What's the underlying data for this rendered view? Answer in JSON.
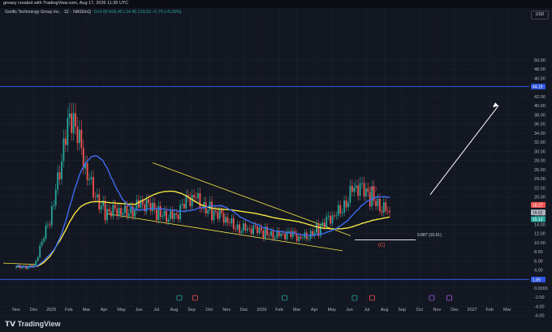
{
  "header": {
    "credit": "greasy created with TradingView.com, Aug 17, 2026 11:35 UTC"
  },
  "legend": {
    "symbol": "Gorilla Technology Group Inc. · 1D · NASDAQ",
    "ohlc": "O14.85 H16.48 L14.45 C16.62 +0.79 (+5.28%)"
  },
  "currency": "USD",
  "footer": {
    "brand": "TradingView",
    "brand_icon": "tradingview-logo-icon"
  },
  "price_axis": [
    "50.00",
    "48.00",
    "46.00",
    "42.00",
    "40.00",
    "38.00",
    "36.00",
    "34.00",
    "32.00",
    "30.00",
    "28.00",
    "26.00",
    "24.00",
    "22.00",
    "20.00",
    "18.00",
    "16.00",
    "14.00",
    "12.00",
    "10.00",
    "8.00",
    "6.00",
    "4.00",
    "2.00",
    "0.0000",
    "-2.00",
    "-4.00",
    "-6.00"
  ],
  "time_axis": [
    "Nov",
    "Dec",
    "2025",
    "Feb",
    "Mar",
    "Apr",
    "May",
    "Jun",
    "Jul",
    "Aug",
    "Sep",
    "Oct",
    "Nov",
    "Dec",
    "2026",
    "Feb",
    "Mar",
    "Apr",
    "May",
    "Jun",
    "Jul",
    "Aug",
    "Sep",
    "Oct",
    "Nov",
    "Dec",
    "2027",
    "Feb",
    "Mar"
  ],
  "price_tags": {
    "resistance": "44.19",
    "last_red": "18.27",
    "last_gray": "16.62",
    "last_green": "15.13",
    "support": "1.89"
  },
  "annotations": {
    "wave_b": "(B)",
    "wave_c": "(C)",
    "fib": "0.887 (10.61)"
  },
  "colors": {
    "up": "#26a69a",
    "down": "#ef5350",
    "ma_yellow": "#f5e642",
    "ma_blue": "#3d6cf0",
    "hline": "#3055e0"
  },
  "chart_data": {
    "type": "candlestick",
    "title": "Gorilla Technology Group Inc. · 1D · NASDAQ",
    "ylim": [
      -6,
      51
    ],
    "grid": true,
    "horizontal_lines": [
      44.19,
      1.89
    ],
    "approx_close_path": [
      {
        "x": "Nov 2024",
        "y": 4.5
      },
      {
        "x": "Dec 2024",
        "y": 5.0
      },
      {
        "x": "Jan 2025",
        "y": 16
      },
      {
        "x": "Feb 2025",
        "y": 40
      },
      {
        "x": "Mar 2025",
        "y": 24
      },
      {
        "x": "Apr 2025",
        "y": 17
      },
      {
        "x": "May 2025",
        "y": 16
      },
      {
        "x": "Jun 2025",
        "y": 19
      },
      {
        "x": "Jul 2025",
        "y": 16
      },
      {
        "x": "Aug 2025",
        "y": 16.5
      },
      {
        "x": "Sep 2025",
        "y": 20
      },
      {
        "x": "Oct 2025",
        "y": 17
      },
      {
        "x": "Nov 2025",
        "y": 14
      },
      {
        "x": "Dec 2025",
        "y": 13
      },
      {
        "x": "Jan 2026",
        "y": 12
      },
      {
        "x": "Feb 2026",
        "y": 12
      },
      {
        "x": "Mar 2026",
        "y": 11
      },
      {
        "x": "Apr 2026",
        "y": 13
      },
      {
        "x": "May 2026",
        "y": 16
      },
      {
        "x": "Jun 2026",
        "y": 22
      },
      {
        "x": "Jul 2026",
        "y": 20
      },
      {
        "x": "Aug 2026",
        "y": 16.6
      }
    ]
  }
}
